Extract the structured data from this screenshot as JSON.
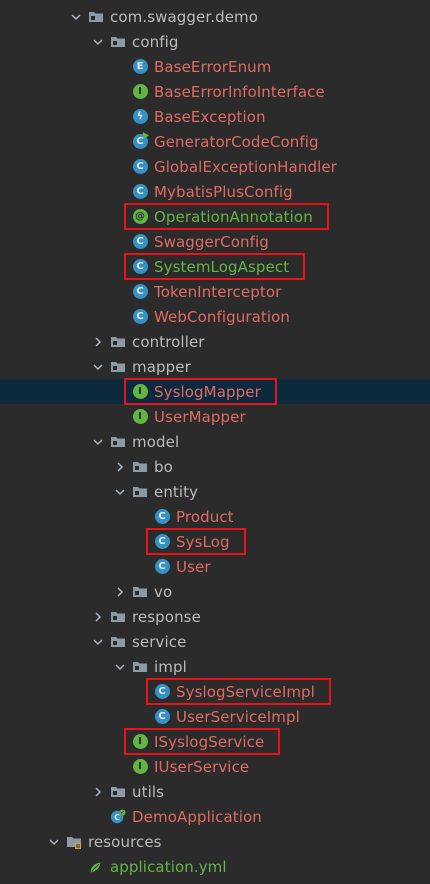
{
  "colors": {
    "background": "#2b2b2b",
    "selection": "#0d293e",
    "folder_text": "#bbbbbb",
    "modified_text": "#e06b62",
    "added_text": "#62b543",
    "highlight_border": "#e8141a"
  },
  "tree": [
    {
      "label": "com.swagger.demo",
      "kind": "package",
      "chevron": "down",
      "color": "folder_text",
      "level": 0
    },
    {
      "label": "config",
      "kind": "package",
      "chevron": "down",
      "color": "folder_text",
      "level": 1
    },
    {
      "label": "BaseErrorEnum",
      "kind": "enum",
      "icon_name": "enum-icon",
      "color": "modified_text",
      "level": 2
    },
    {
      "label": "BaseErrorInfoInterface",
      "kind": "interface",
      "icon_name": "interface-icon",
      "color": "modified_text",
      "level": 2
    },
    {
      "label": "BaseException",
      "kind": "exception",
      "icon_name": "exception-class-icon",
      "color": "modified_text",
      "level": 2
    },
    {
      "label": "GeneratorCodeConfig",
      "kind": "main-class",
      "icon_name": "runnable-class-icon",
      "color": "modified_text",
      "level": 2
    },
    {
      "label": "GlobalExceptionHandler",
      "kind": "class",
      "icon_name": "class-icon",
      "color": "modified_text",
      "level": 2
    },
    {
      "label": "MybatisPlusConfig",
      "kind": "class",
      "icon_name": "class-icon",
      "color": "modified_text",
      "level": 2
    },
    {
      "label": "OperationAnnotation",
      "kind": "annotation",
      "icon_name": "annotation-icon",
      "color": "added_text",
      "level": 2,
      "highlight": true
    },
    {
      "label": "SwaggerConfig",
      "kind": "class",
      "icon_name": "class-icon",
      "color": "modified_text",
      "level": 2
    },
    {
      "label": "SystemLogAspect",
      "kind": "class",
      "icon_name": "class-icon",
      "color": "added_text",
      "level": 2,
      "highlight": true
    },
    {
      "label": "TokenInterceptor",
      "kind": "class",
      "icon_name": "class-icon",
      "color": "modified_text",
      "level": 2
    },
    {
      "label": "WebConfiguration",
      "kind": "class",
      "icon_name": "class-icon",
      "color": "modified_text",
      "level": 2
    },
    {
      "label": "controller",
      "kind": "package",
      "chevron": "right",
      "color": "folder_text",
      "level": 1
    },
    {
      "label": "mapper",
      "kind": "package",
      "chevron": "down",
      "color": "folder_text",
      "level": 1
    },
    {
      "label": "SyslogMapper",
      "kind": "interface",
      "icon_name": "interface-icon",
      "color": "modified_text",
      "level": 2,
      "highlight": true,
      "selected": true
    },
    {
      "label": "UserMapper",
      "kind": "interface",
      "icon_name": "interface-icon",
      "color": "modified_text",
      "level": 2
    },
    {
      "label": "model",
      "kind": "package",
      "chevron": "down",
      "color": "folder_text",
      "level": 1
    },
    {
      "label": "bo",
      "kind": "package",
      "chevron": "right",
      "color": "folder_text",
      "level": 2
    },
    {
      "label": "entity",
      "kind": "package",
      "chevron": "down",
      "color": "folder_text",
      "level": 2
    },
    {
      "label": "Product",
      "kind": "class",
      "icon_name": "class-icon",
      "color": "modified_text",
      "level": 3
    },
    {
      "label": "SysLog",
      "kind": "class",
      "icon_name": "class-icon",
      "color": "modified_text",
      "level": 3,
      "highlight": true
    },
    {
      "label": "User",
      "kind": "class",
      "icon_name": "class-icon",
      "color": "modified_text",
      "level": 3
    },
    {
      "label": "vo",
      "kind": "package",
      "chevron": "right",
      "color": "folder_text",
      "level": 2
    },
    {
      "label": "response",
      "kind": "package",
      "chevron": "right",
      "color": "folder_text",
      "level": 1
    },
    {
      "label": "service",
      "kind": "package",
      "chevron": "down",
      "color": "folder_text",
      "level": 1
    },
    {
      "label": "impl",
      "kind": "package",
      "chevron": "down",
      "color": "folder_text",
      "level": 2
    },
    {
      "label": "SyslogServiceImpl",
      "kind": "class",
      "icon_name": "class-icon",
      "color": "modified_text",
      "level": 3,
      "highlight": true
    },
    {
      "label": "UserServiceImpl",
      "kind": "class",
      "icon_name": "class-icon",
      "color": "modified_text",
      "level": 3
    },
    {
      "label": "ISyslogService",
      "kind": "interface",
      "icon_name": "interface-icon",
      "color": "modified_text",
      "level": 2,
      "highlight": true
    },
    {
      "label": "IUserService",
      "kind": "interface",
      "icon_name": "interface-icon",
      "color": "modified_text",
      "level": 2
    },
    {
      "label": "utils",
      "kind": "package",
      "chevron": "right",
      "color": "folder_text",
      "level": 1
    },
    {
      "label": "DemoApplication",
      "kind": "spring-boot-class",
      "icon_name": "spring-boot-class-icon",
      "color": "modified_text",
      "level": 1
    },
    {
      "label": "resources",
      "kind": "resources-folder",
      "icon_name": "resources-folder-icon",
      "chevron": "down",
      "color": "folder_text",
      "level": -1
    },
    {
      "label": "application.yml",
      "kind": "yaml-file",
      "icon_name": "yaml-file-icon",
      "color": "added_text",
      "level": 0
    }
  ]
}
